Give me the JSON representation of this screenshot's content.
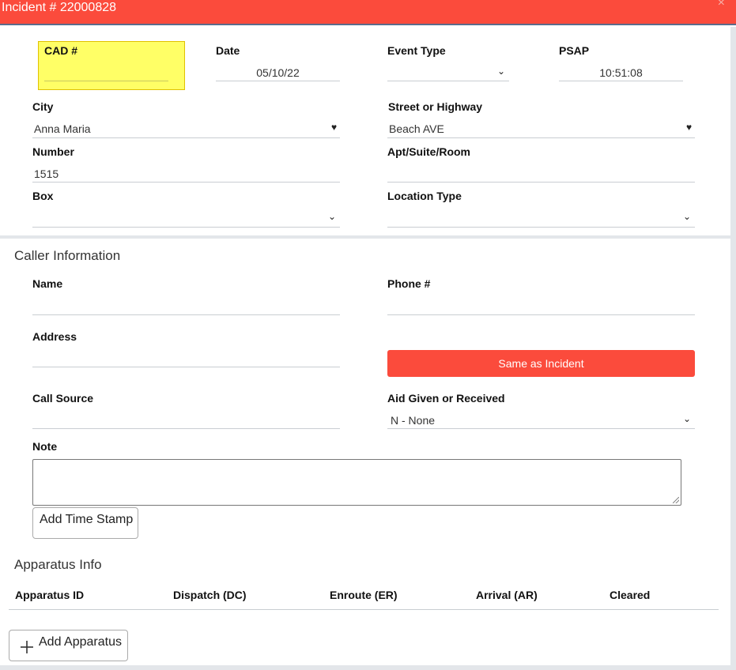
{
  "window": {
    "title": "Incident # 22000828",
    "close_glyph": "×"
  },
  "incident": {
    "cad": {
      "label": "CAD #",
      "value": ""
    },
    "date": {
      "label": "Date",
      "value": "05/10/22"
    },
    "event_type": {
      "label": "Event Type",
      "value": ""
    },
    "psap": {
      "label": "PSAP",
      "value": "10:51:08"
    },
    "city": {
      "label": "City",
      "value": "Anna Maria"
    },
    "street": {
      "label": "Street or Highway",
      "value": "Beach AVE"
    },
    "number": {
      "label": "Number",
      "value": "1515"
    },
    "apt": {
      "label": "Apt/Suite/Room",
      "value": ""
    },
    "box": {
      "label": "Box",
      "value": ""
    },
    "location_type": {
      "label": "Location Type",
      "value": ""
    }
  },
  "caller": {
    "section_title": "Caller Information",
    "name": {
      "label": "Name",
      "value": ""
    },
    "phone": {
      "label": "Phone #",
      "value": ""
    },
    "address": {
      "label": "Address",
      "value": ""
    },
    "same_as_incident_label": "Same as Incident",
    "call_source": {
      "label": "Call Source",
      "value": ""
    },
    "aid": {
      "label": "Aid Given or Received",
      "value": "N - None"
    },
    "note": {
      "label": "Note",
      "value": ""
    },
    "add_time_stamp_label": "Add Time Stamp"
  },
  "apparatus": {
    "section_title": "Apparatus Info",
    "columns": [
      "Apparatus ID",
      "Dispatch (DC)",
      "Enroute (ER)",
      "Arrival (AR)",
      "Cleared"
    ],
    "add_label": "Add Apparatus"
  },
  "colors": {
    "accent": "#fb4b3c",
    "highlight": "#ffff66",
    "panel_gap": "#e3e6ea"
  },
  "icons": {
    "dropdown": "chevron-down-icon",
    "combo": "heart-chevron-icon",
    "add": "plus-icon",
    "close": "close-icon"
  }
}
